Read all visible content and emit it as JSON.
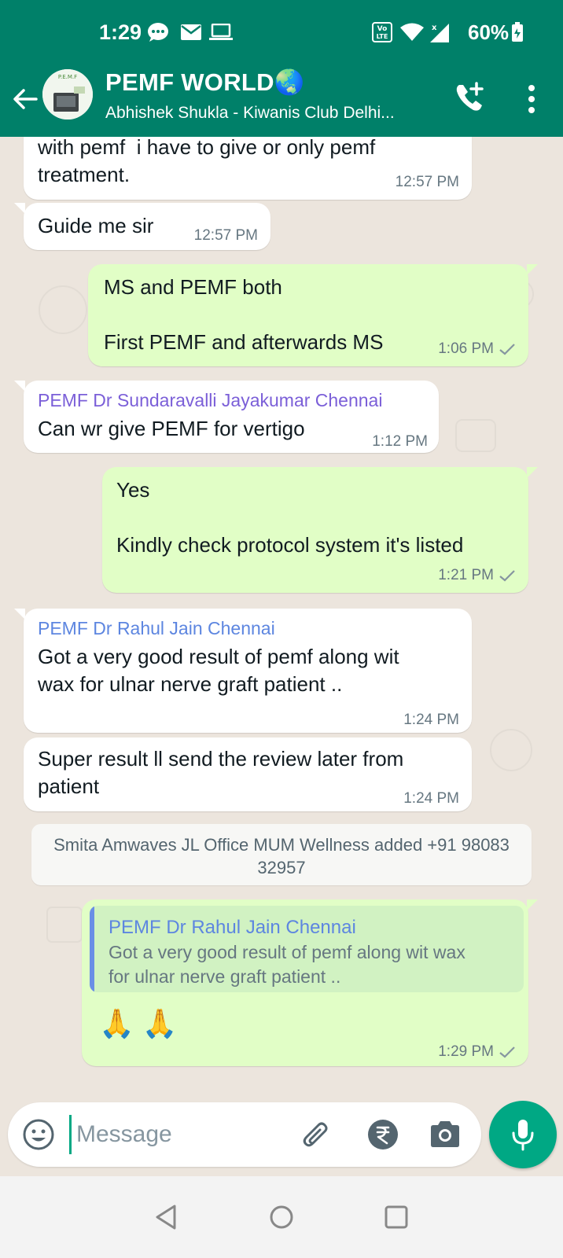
{
  "status_bar": {
    "time": "1:29",
    "battery_percent": "60%",
    "volte_label": "Vo LTE",
    "icons": [
      "chat-bubble-icon",
      "mail-icon",
      "laptop-icon",
      "volte-icon",
      "wifi-icon",
      "signal-icon",
      "battery-icon"
    ]
  },
  "header": {
    "title": "PEMF WORLD🌏",
    "subtitle": "Abhishek Shukla - Kiwanis Club Delhi...",
    "avatar_text": "P.E.M.F",
    "icons": [
      "back-arrow-icon",
      "add-call-icon",
      "more-vert-icon"
    ]
  },
  "messages": [
    {
      "direction": "in",
      "text": "with pemf  i have to give or only pemf\ntreatment.",
      "time": "12:57 PM"
    },
    {
      "direction": "in",
      "text": "Guide me sir",
      "time": "12:57 PM"
    },
    {
      "direction": "out",
      "text": "MS and PEMF both\n\nFirst PEMF and afterwards MS",
      "time": "1:06 PM",
      "status": "sent"
    },
    {
      "direction": "in",
      "sender": "PEMF Dr Sundaravalli Jayakumar Chennai",
      "sender_color": "#7b5fd8",
      "text": "Can wr give PEMF for vertigo",
      "time": "1:12 PM"
    },
    {
      "direction": "out",
      "text": "Yes\n\nKindly check protocol system it's listed",
      "time": "1:21 PM",
      "status": "sent"
    },
    {
      "direction": "in",
      "sender": "PEMF Dr Rahul Jain Chennai",
      "sender_color": "#5d86e0",
      "text": "Got a very good result of pemf along wit\nwax for ulnar nerve graft patient ..",
      "time": "1:24 PM"
    },
    {
      "direction": "in",
      "text": "Super result ll send the review later from\npatient",
      "time": "1:24 PM"
    },
    {
      "direction": "out",
      "quoted_sender": "PEMF Dr Rahul Jain Chennai",
      "quoted_text": "Got a very good result of pemf along wit wax\nfor ulnar nerve graft patient ..",
      "text": "🙏 🙏",
      "time": "1:29 PM",
      "status": "sent"
    }
  ],
  "system_message": "Smita Amwaves JL Office MUM Wellness added +91 98083 32957",
  "composer": {
    "placeholder": "Message",
    "icons": [
      "emoji-icon",
      "attach-icon",
      "rupee-payment-icon",
      "camera-icon",
      "mic-icon"
    ]
  },
  "nav": {
    "icons": [
      "back-triangle-icon",
      "home-circle-icon",
      "recents-square-icon"
    ]
  },
  "colors": {
    "header": "#008069",
    "outgoing_bubble": "#e1fec6",
    "incoming_bubble": "#ffffff",
    "chat_background": "#ece5dd",
    "accent": "#00a884"
  }
}
